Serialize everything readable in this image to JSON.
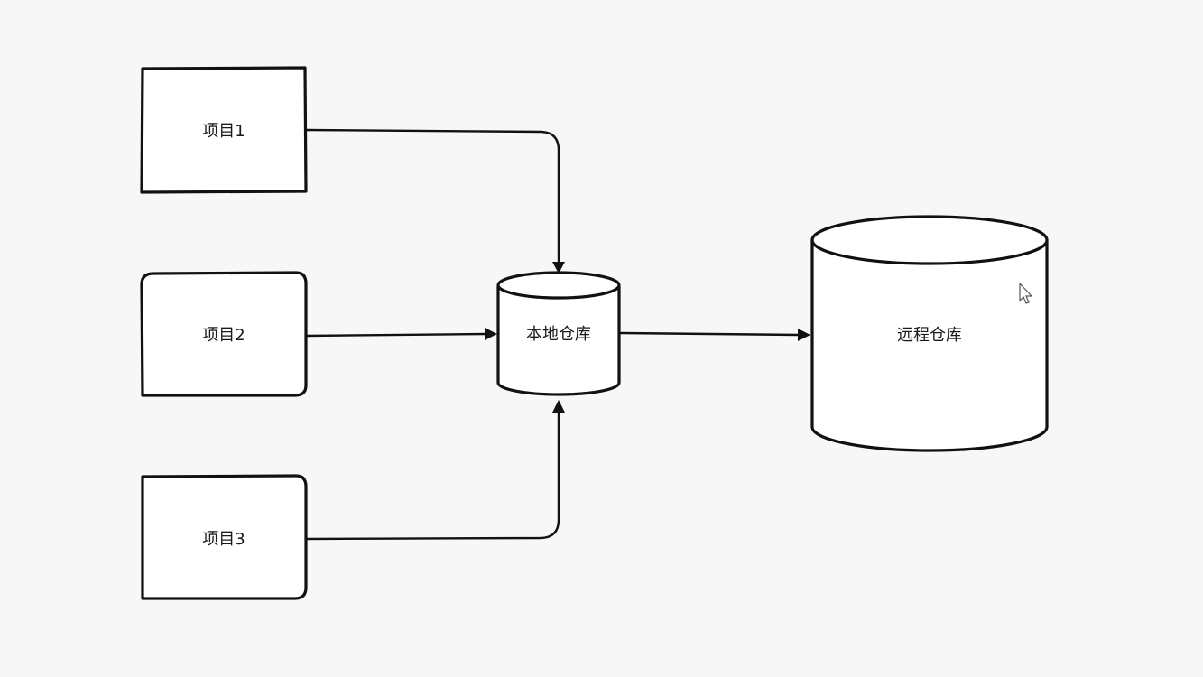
{
  "diagram": {
    "nodes": [
      {
        "id": "p1",
        "kind": "box",
        "label": "项目1"
      },
      {
        "id": "p2",
        "kind": "box",
        "label": "项目2"
      },
      {
        "id": "p3",
        "kind": "box",
        "label": "项目3"
      },
      {
        "id": "local",
        "kind": "database",
        "label": "本地仓库"
      },
      {
        "id": "remote",
        "kind": "database",
        "label": "远程仓库"
      }
    ],
    "edges": [
      {
        "from": "p1",
        "to": "local"
      },
      {
        "from": "p2",
        "to": "local"
      },
      {
        "from": "p3",
        "to": "local"
      },
      {
        "from": "local",
        "to": "remote"
      }
    ]
  },
  "icons": {
    "cursor": "mouse-pointer-icon"
  },
  "colors": {
    "background": "#f7f7f7",
    "stroke": "#111111",
    "fill": "#ffffff"
  }
}
